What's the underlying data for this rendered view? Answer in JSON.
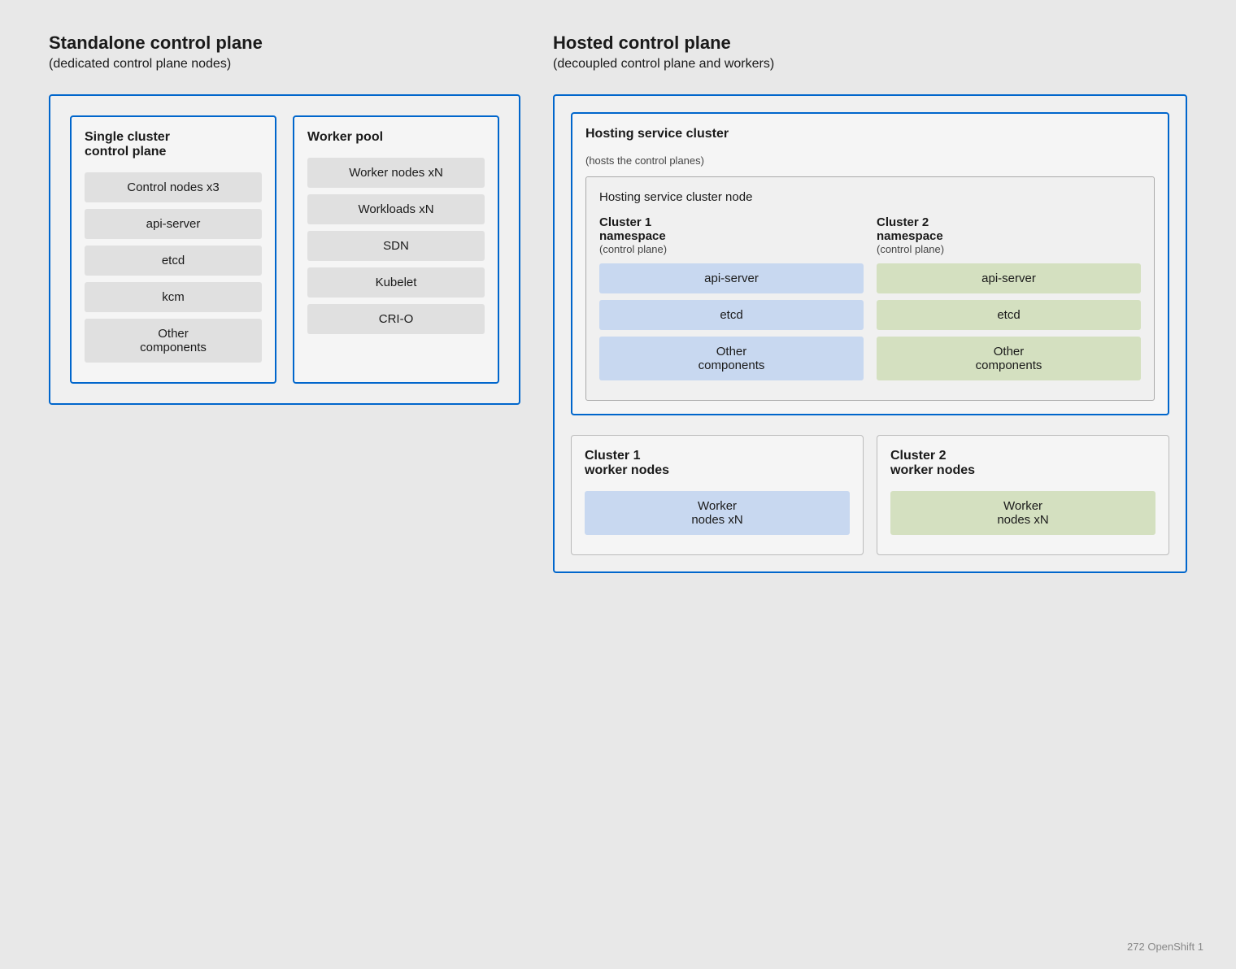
{
  "left": {
    "title": "Standalone control plane",
    "subtitle": "(dedicated control plane nodes)",
    "control_plane_title": "Single cluster\ncontrol plane",
    "control_nodes_label": "Control nodes  x3",
    "components": [
      "api-server",
      "etcd",
      "kcm",
      "Other\ncomponents"
    ],
    "worker_pool_title": "Worker pool",
    "worker_nodes_label": "Worker nodes  xN",
    "worker_components": [
      "Workloads  xN",
      "SDN",
      "Kubelet",
      "CRI-O"
    ]
  },
  "right": {
    "title": "Hosted control plane",
    "subtitle": "(decoupled control plane and workers)",
    "hosting_service_cluster_title": "Hosting service cluster",
    "hosting_service_cluster_subtitle": "(hosts the control planes)",
    "hosting_node_title": "Hosting service cluster node",
    "cluster1_ns_title": "Cluster 1\nnamespace",
    "cluster1_ns_subtitle": "(control plane)",
    "cluster1_components": [
      "api-server",
      "etcd",
      "Other\ncomponents"
    ],
    "cluster2_ns_title": "Cluster 2\nnamespace",
    "cluster2_ns_subtitle": "(control plane)",
    "cluster2_components": [
      "api-server",
      "etcd",
      "Other\ncomponents"
    ],
    "cluster1_worker_title": "Cluster 1\nworker nodes",
    "cluster1_worker_item": "Worker\nnodes  xN",
    "cluster2_worker_title": "Cluster 2\nworker nodes",
    "cluster2_worker_item": "Worker\nnodes  xN"
  },
  "footer": "272  OpenShift  1"
}
